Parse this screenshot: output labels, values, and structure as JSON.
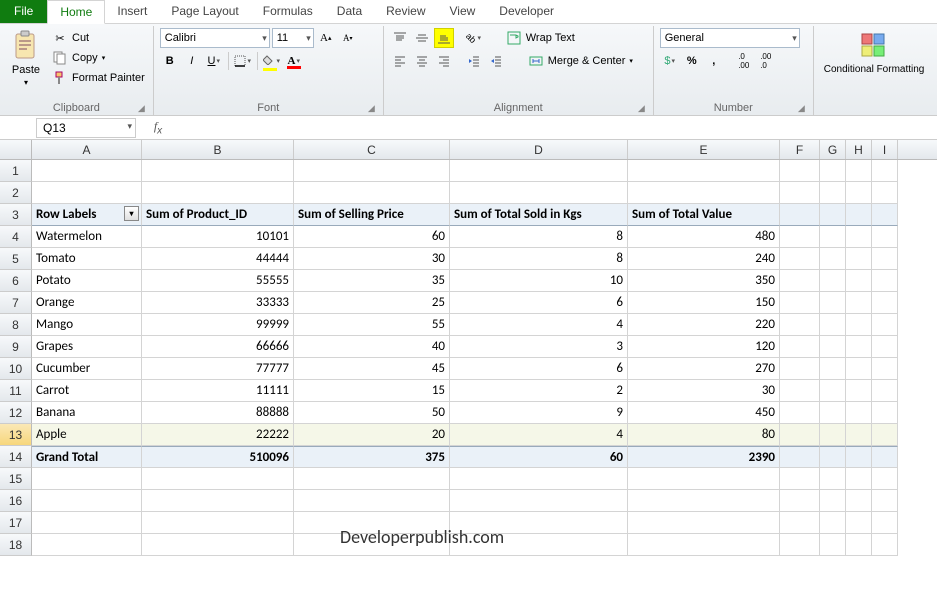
{
  "tabs": {
    "file": "File",
    "items": [
      "Home",
      "Insert",
      "Page Layout",
      "Formulas",
      "Data",
      "Review",
      "View",
      "Developer"
    ],
    "active": "Home"
  },
  "ribbon": {
    "clipboard": {
      "label": "Clipboard",
      "paste": "Paste",
      "cut": "Cut",
      "copy": "Copy",
      "format_painter": "Format Painter"
    },
    "font": {
      "label": "Font",
      "font_name": "Calibri",
      "font_size": "11"
    },
    "alignment": {
      "label": "Alignment",
      "wrap": "Wrap Text",
      "merge": "Merge & Center"
    },
    "number": {
      "label": "Number",
      "format": "General"
    },
    "cf": {
      "label": "Conditional Formatting"
    }
  },
  "formula_bar": {
    "cell_ref": "Q13",
    "value": ""
  },
  "columns": [
    "A",
    "B",
    "C",
    "D",
    "E",
    "F",
    "G",
    "H",
    "I"
  ],
  "headers": {
    "A": "Row Labels",
    "B": "Sum of Product_ID",
    "C": "Sum of Selling Price",
    "D": "Sum of Total Sold in Kgs",
    "E": "Sum of Total Value"
  },
  "rows": [
    {
      "A": "Watermelon",
      "B": "10101",
      "C": "60",
      "D": "8",
      "E": "480"
    },
    {
      "A": "Tomato",
      "B": "44444",
      "C": "30",
      "D": "8",
      "E": "240"
    },
    {
      "A": "Potato",
      "B": "55555",
      "C": "35",
      "D": "10",
      "E": "350"
    },
    {
      "A": "Orange",
      "B": "33333",
      "C": "25",
      "D": "6",
      "E": "150"
    },
    {
      "A": "Mango",
      "B": "99999",
      "C": "55",
      "D": "4",
      "E": "220"
    },
    {
      "A": "Grapes",
      "B": "66666",
      "C": "40",
      "D": "3",
      "E": "120"
    },
    {
      "A": "Cucumber",
      "B": "77777",
      "C": "45",
      "D": "6",
      "E": "270"
    },
    {
      "A": "Carrot",
      "B": "11111",
      "C": "15",
      "D": "2",
      "E": "30"
    },
    {
      "A": "Banana",
      "B": "88888",
      "C": "50",
      "D": "9",
      "E": "450"
    },
    {
      "A": "Apple",
      "B": "22222",
      "C": "20",
      "D": "4",
      "E": "80"
    }
  ],
  "grand_total": {
    "A": "Grand Total",
    "B": "510096",
    "C": "375",
    "D": "60",
    "E": "2390"
  },
  "watermark": "Developerpublish.com",
  "selected_row": 13
}
